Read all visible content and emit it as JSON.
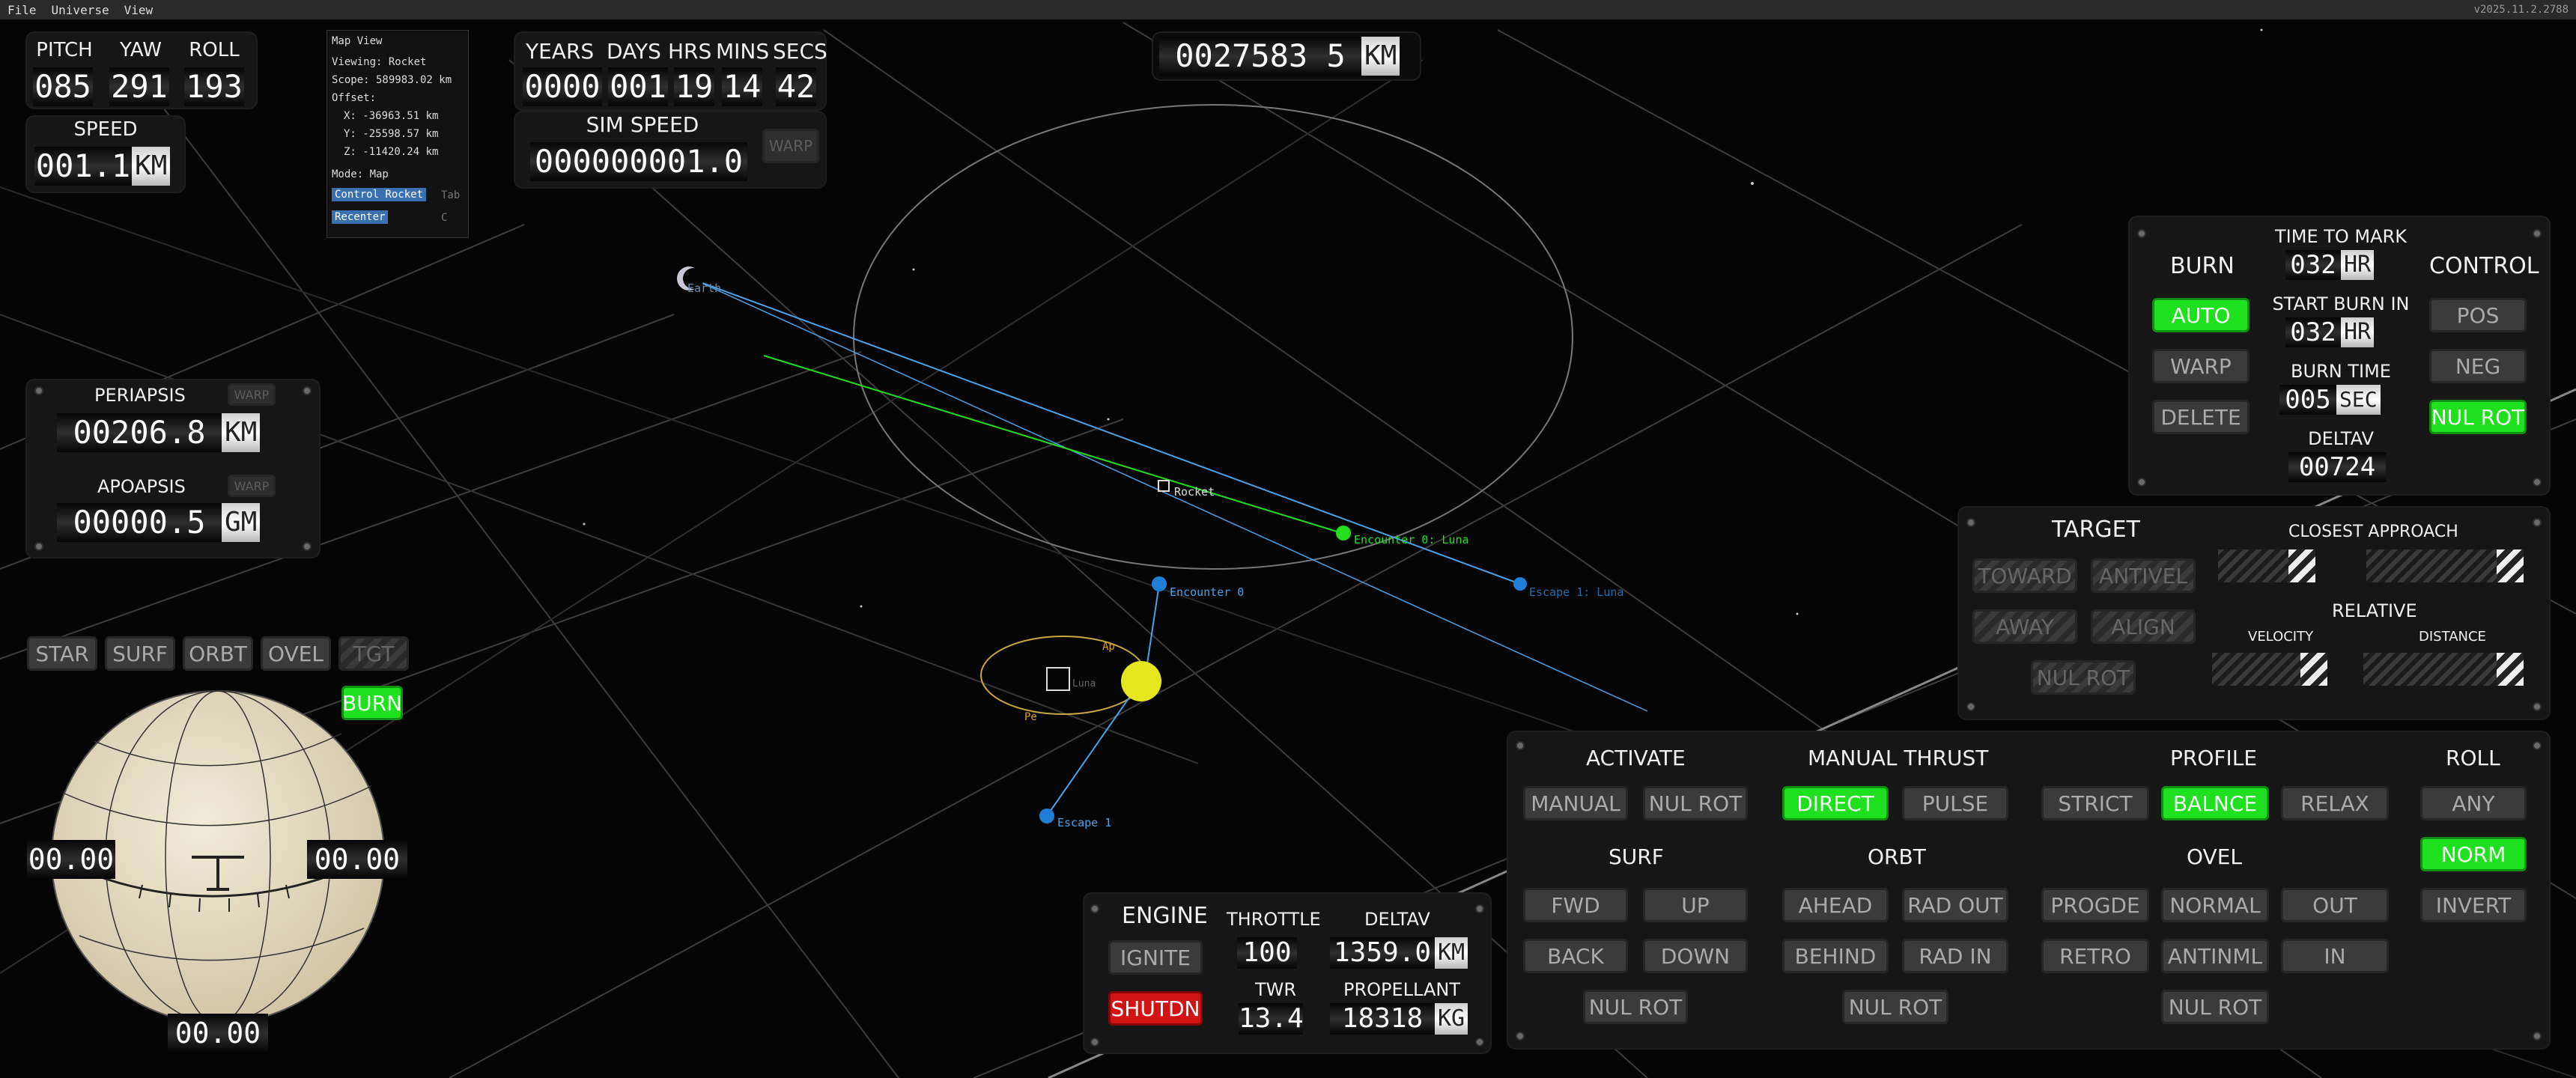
{
  "menu": {
    "file": "File",
    "universe": "Universe",
    "view": "View",
    "version": "v2025.11.2.2788"
  },
  "attitude": {
    "pitch_label": "PITCH",
    "yaw_label": "YAW",
    "roll_label": "ROLL",
    "pitch": "085",
    "yaw": "291",
    "roll": "193"
  },
  "speed": {
    "label": "SPEED",
    "value": "001.1",
    "unit": "KM"
  },
  "map_view": {
    "title": "Map View",
    "viewing": "Viewing: Rocket",
    "scope": "Scope: 589983.02 km",
    "offset": "Offset:",
    "x": "X: -36963.51 km",
    "y": "Y: -25598.57 km",
    "z": "Z: -11420.24 km",
    "mode": "Mode: Map",
    "control_rocket": "Control Rocket",
    "control_key": "Tab",
    "recenter": "Recenter",
    "recenter_key": "C"
  },
  "time": {
    "years_label": "YEARS",
    "days_label": "DAYS",
    "hrs_label": "HRS",
    "mins_label": "MINS",
    "secs_label": "SECS",
    "years": "0000",
    "days": "001",
    "hrs": "19",
    "mins": "14",
    "secs": "42"
  },
  "sim_speed": {
    "label": "SIM SPEED",
    "value": "000000001.0",
    "warp": "WARP"
  },
  "distance": {
    "value": "0027583 5",
    "unit": "KM"
  },
  "orbit": {
    "periapsis_label": "PERIAPSIS",
    "periapsis": "00206.8",
    "periapsis_unit": "KM",
    "apoapsis_label": "APOAPSIS",
    "apoapsis": "00000.5",
    "apoapsis_unit": "GM",
    "warp": "WARP"
  },
  "nav_modes": [
    "STAR",
    "SURF",
    "ORBT",
    "OVEL",
    "TGT"
  ],
  "burn_toggle": "BURN",
  "navball": {
    "left": "00.00",
    "right": "00.00",
    "bottom": "00.00"
  },
  "scene_labels": {
    "earth": "Earth",
    "rocket": "Rocket",
    "encounter0": "Encounter 0",
    "encounter1": "Encounter 0: Luna",
    "escape1_luna": "Escape 1: Luna",
    "escape1": "Escape 1",
    "luna": "Luna",
    "ap": "Ap",
    "pe": "Pe"
  },
  "burn": {
    "burn_label": "BURN",
    "auto": "AUTO",
    "warp": "WARP",
    "delete": "DELETE",
    "time_to_mark_label": "TIME TO MARK",
    "time_to_mark": "032",
    "time_to_mark_unit": "HR",
    "start_burn_label": "START BURN IN",
    "start_burn": "032",
    "start_burn_unit": "HR",
    "burn_time_label": "BURN TIME",
    "burn_time": "005",
    "burn_time_unit": "SEC",
    "deltav_label": "DELTAV",
    "deltav": "00724",
    "control_label": "CONTROL",
    "pos": "POS",
    "neg": "NEG",
    "nul_rot": "NUL ROT"
  },
  "target": {
    "label": "TARGET",
    "toward": "TOWARD",
    "antivel": "ANTIVEL",
    "away": "AWAY",
    "align": "ALIGN",
    "nul_rot": "NUL ROT",
    "closest_label": "CLOSEST APPROACH",
    "relative_label": "RELATIVE",
    "velocity_label": "VELOCITY",
    "distance_label": "DISTANCE"
  },
  "engine": {
    "label": "ENGINE",
    "ignite": "IGNITE",
    "shutdn": "SHUTDN",
    "throttle_label": "THROTTLE",
    "throttle": "100",
    "twr_label": "TWR",
    "twr": "13.4",
    "deltav_label": "DELTAV",
    "deltav": "1359.0",
    "deltav_unit": "KM",
    "propellant_label": "PROPELLANT",
    "propellant": "18318",
    "propellant_unit": "KG"
  },
  "controls": {
    "activate_label": "ACTIVATE",
    "manual": "MANUAL",
    "nul_rot": "NUL ROT",
    "manual_thrust_label": "MANUAL THRUST",
    "direct": "DIRECT",
    "pulse": "PULSE",
    "profile_label": "PROFILE",
    "strict": "STRICT",
    "balnce": "BALNCE",
    "relax": "RELAX",
    "roll_label": "ROLL",
    "any": "ANY",
    "norm": "NORM",
    "invert": "INVERT",
    "surf_label": "SURF",
    "fwd": "FWD",
    "up": "UP",
    "back": "BACK",
    "down": "DOWN",
    "orbt_label": "ORBT",
    "ahead": "AHEAD",
    "rad_out": "RAD OUT",
    "behind": "BEHIND",
    "rad_in": "RAD IN",
    "ovel_label": "OVEL",
    "progde": "PROGDE",
    "normal": "NORMAL",
    "out": "OUT",
    "retro": "RETRO",
    "antinml": "ANTINML",
    "in": "IN"
  },
  "colors": {
    "active": "#1fe01f",
    "shutdn": "#d21313",
    "orbit_blue": "#4aa3e8",
    "orbit_green": "#22dd22",
    "luna_yellow": "#e6e61e"
  }
}
